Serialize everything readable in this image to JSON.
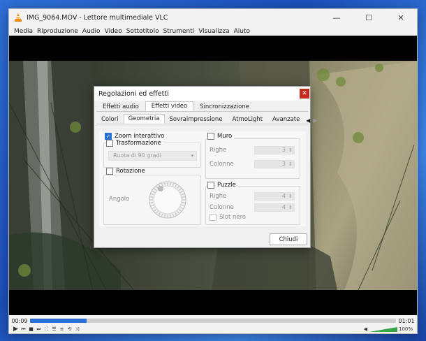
{
  "window": {
    "title": "IMG_9064.MOV - Lettore multimediale VLC",
    "minimize": "—",
    "maximize": "☐",
    "close": "✕"
  },
  "menu": [
    "Media",
    "Riproduzione",
    "Audio",
    "Video",
    "Sottotitolo",
    "Strumenti",
    "Visualizza",
    "Aiuto"
  ],
  "player": {
    "elapsed": "00:09",
    "total": "01:01",
    "progress": 0.155,
    "volume_label": "100%",
    "volume": 1.0
  },
  "dialog": {
    "title": "Regolazioni ed effetti",
    "close_glyph": "✕",
    "tabs": [
      "Effetti audio",
      "Effetti video",
      "Sincronizzazione"
    ],
    "active_tab": 1,
    "subtabs": [
      "Colori",
      "Geometria",
      "Sovraimpressione",
      "AtmoLight",
      "Avanzate"
    ],
    "active_subtab": 1,
    "geometry": {
      "zoom_label": "Zoom interattivo",
      "zoom_checked": true,
      "transform_label": "Trasformazione",
      "transform_value": "Ruota di 90 gradi",
      "rotation_label": "Rotazione",
      "angle_label": "Angolo",
      "wall_label": "Muro",
      "rows_label": "Righe",
      "rows_value": "3",
      "cols_label": "Colonne",
      "cols_value": "3",
      "puzzle_label": "Puzzle",
      "puzzle_rows_label": "Righe",
      "puzzle_rows_value": "4",
      "puzzle_cols_label": "Colonne",
      "puzzle_cols_value": "4",
      "black_slot_label": "Slot nero"
    },
    "close_button": "Chiudi"
  },
  "colors": {
    "accent": "#2a6fd6",
    "close_red": "#c42b1c",
    "vlc_orange": "#f08a00"
  }
}
